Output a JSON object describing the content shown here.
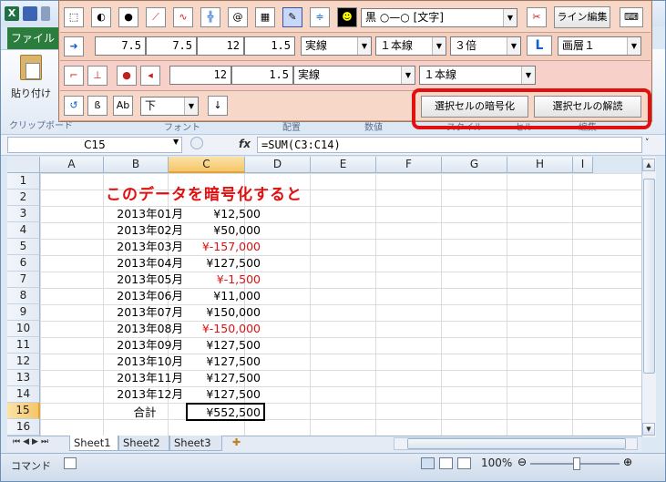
{
  "app": {
    "file_tab": "ファイル",
    "paste_label": "貼り付け",
    "clipboard_label": "クリップボード",
    "group_labels": [
      "フォント",
      "配置",
      "数値",
      "スタイル",
      "セル",
      "編集"
    ]
  },
  "toolbar": {
    "row1": {
      "color_select": "黒 ○—○ [文字]",
      "line_edit": "ライン編集"
    },
    "row2": {
      "v1": "7.5",
      "v2": "7.5",
      "v3": "12",
      "v4": "1.5",
      "line_type": "実線",
      "line_count": "１本線",
      "multiplier": "３倍",
      "L_label": "L",
      "layer": "画層１"
    },
    "row3": {
      "v1": "12",
      "v2": "1.5",
      "line_type": "実線",
      "line_count": "１本線"
    },
    "row4": {
      "direction": "下",
      "encrypt_button": "選択セルの暗号化",
      "decrypt_button": "選択セルの解読"
    }
  },
  "formula_bar": {
    "name_box": "C15",
    "fx": "fx",
    "formula": "=SUM(C3:C14)"
  },
  "grid": {
    "columns": [
      "A",
      "B",
      "C",
      "D",
      "E",
      "F",
      "G",
      "H",
      "I"
    ],
    "rows": [
      "1",
      "2",
      "3",
      "4",
      "5",
      "6",
      "7",
      "8",
      "9",
      "10",
      "11",
      "12",
      "13",
      "14",
      "15",
      "16"
    ],
    "headline": "このデータを暗号化すると",
    "data": [
      {
        "month": "2013年01月",
        "amount": "¥12,500",
        "neg": false
      },
      {
        "month": "2013年02月",
        "amount": "¥50,000",
        "neg": false
      },
      {
        "month": "2013年03月",
        "amount": "¥-157,000",
        "neg": true
      },
      {
        "month": "2013年04月",
        "amount": "¥127,500",
        "neg": false
      },
      {
        "month": "2013年05月",
        "amount": "¥-1,500",
        "neg": true
      },
      {
        "month": "2013年06月",
        "amount": "¥11,000",
        "neg": false
      },
      {
        "month": "2013年07月",
        "amount": "¥150,000",
        "neg": false
      },
      {
        "month": "2013年08月",
        "amount": "¥-150,000",
        "neg": true
      },
      {
        "month": "2013年09月",
        "amount": "¥127,500",
        "neg": false
      },
      {
        "month": "2013年10月",
        "amount": "¥127,500",
        "neg": false
      },
      {
        "month": "2013年11月",
        "amount": "¥127,500",
        "neg": false
      },
      {
        "month": "2013年12月",
        "amount": "¥127,500",
        "neg": false
      }
    ],
    "total_label": "合計",
    "total_value": "¥552,500"
  },
  "sheets": [
    "Sheet1",
    "Sheet2",
    "Sheet3"
  ],
  "status": {
    "mode": "コマンド",
    "zoom": "100%"
  },
  "colors": {
    "negative": "#e01010",
    "highlight": "#e01010",
    "toolbar_bg": "#f5d0c0"
  }
}
